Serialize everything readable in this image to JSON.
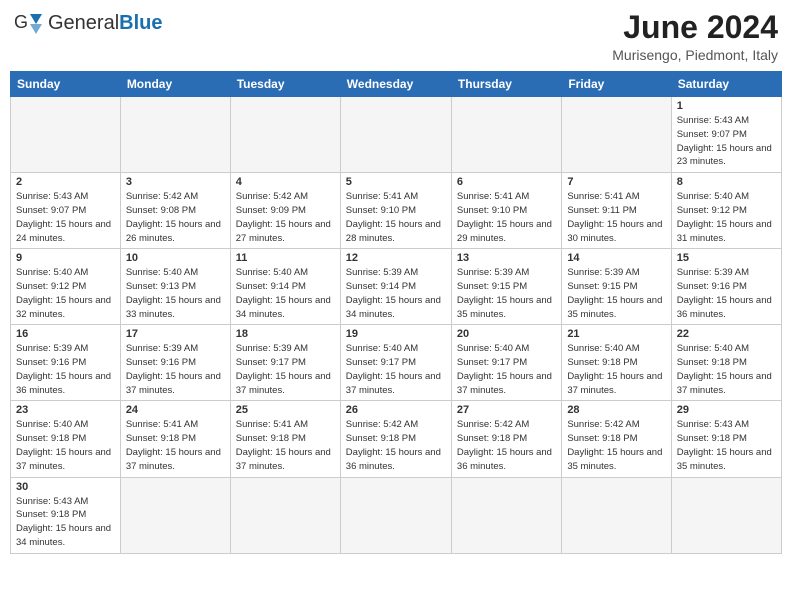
{
  "header": {
    "logo_general": "General",
    "logo_blue": "Blue",
    "month_title": "June 2024",
    "subtitle": "Murisengo, Piedmont, Italy"
  },
  "weekdays": [
    "Sunday",
    "Monday",
    "Tuesday",
    "Wednesday",
    "Thursday",
    "Friday",
    "Saturday"
  ],
  "weeks": [
    [
      {
        "day": "",
        "empty": true
      },
      {
        "day": "",
        "empty": true
      },
      {
        "day": "",
        "empty": true
      },
      {
        "day": "",
        "empty": true
      },
      {
        "day": "",
        "empty": true
      },
      {
        "day": "",
        "empty": true
      },
      {
        "day": "1",
        "info": "Sunrise: 5:43 AM\nSunset: 9:07 PM\nDaylight: 15 hours\nand 23 minutes."
      }
    ],
    [
      {
        "day": "2",
        "info": "Sunrise: 5:43 AM\nSunset: 9:07 PM\nDaylight: 15 hours\nand 24 minutes."
      },
      {
        "day": "3",
        "info": "Sunrise: 5:42 AM\nSunset: 9:08 PM\nDaylight: 15 hours\nand 26 minutes."
      },
      {
        "day": "4",
        "info": "Sunrise: 5:42 AM\nSunset: 9:09 PM\nDaylight: 15 hours\nand 27 minutes."
      },
      {
        "day": "5",
        "info": "Sunrise: 5:41 AM\nSunset: 9:10 PM\nDaylight: 15 hours\nand 28 minutes."
      },
      {
        "day": "6",
        "info": "Sunrise: 5:41 AM\nSunset: 9:10 PM\nDaylight: 15 hours\nand 29 minutes."
      },
      {
        "day": "7",
        "info": "Sunrise: 5:41 AM\nSunset: 9:11 PM\nDaylight: 15 hours\nand 30 minutes."
      },
      {
        "day": "8",
        "info": "Sunrise: 5:40 AM\nSunset: 9:12 PM\nDaylight: 15 hours\nand 31 minutes."
      }
    ],
    [
      {
        "day": "9",
        "info": "Sunrise: 5:40 AM\nSunset: 9:12 PM\nDaylight: 15 hours\nand 32 minutes."
      },
      {
        "day": "10",
        "info": "Sunrise: 5:40 AM\nSunset: 9:13 PM\nDaylight: 15 hours\nand 33 minutes."
      },
      {
        "day": "11",
        "info": "Sunrise: 5:40 AM\nSunset: 9:14 PM\nDaylight: 15 hours\nand 34 minutes."
      },
      {
        "day": "12",
        "info": "Sunrise: 5:39 AM\nSunset: 9:14 PM\nDaylight: 15 hours\nand 34 minutes."
      },
      {
        "day": "13",
        "info": "Sunrise: 5:39 AM\nSunset: 9:15 PM\nDaylight: 15 hours\nand 35 minutes."
      },
      {
        "day": "14",
        "info": "Sunrise: 5:39 AM\nSunset: 9:15 PM\nDaylight: 15 hours\nand 35 minutes."
      },
      {
        "day": "15",
        "info": "Sunrise: 5:39 AM\nSunset: 9:16 PM\nDaylight: 15 hours\nand 36 minutes."
      }
    ],
    [
      {
        "day": "16",
        "info": "Sunrise: 5:39 AM\nSunset: 9:16 PM\nDaylight: 15 hours\nand 36 minutes."
      },
      {
        "day": "17",
        "info": "Sunrise: 5:39 AM\nSunset: 9:16 PM\nDaylight: 15 hours\nand 37 minutes."
      },
      {
        "day": "18",
        "info": "Sunrise: 5:39 AM\nSunset: 9:17 PM\nDaylight: 15 hours\nand 37 minutes."
      },
      {
        "day": "19",
        "info": "Sunrise: 5:40 AM\nSunset: 9:17 PM\nDaylight: 15 hours\nand 37 minutes."
      },
      {
        "day": "20",
        "info": "Sunrise: 5:40 AM\nSunset: 9:17 PM\nDaylight: 15 hours\nand 37 minutes."
      },
      {
        "day": "21",
        "info": "Sunrise: 5:40 AM\nSunset: 9:18 PM\nDaylight: 15 hours\nand 37 minutes."
      },
      {
        "day": "22",
        "info": "Sunrise: 5:40 AM\nSunset: 9:18 PM\nDaylight: 15 hours\nand 37 minutes."
      }
    ],
    [
      {
        "day": "23",
        "info": "Sunrise: 5:40 AM\nSunset: 9:18 PM\nDaylight: 15 hours\nand 37 minutes."
      },
      {
        "day": "24",
        "info": "Sunrise: 5:41 AM\nSunset: 9:18 PM\nDaylight: 15 hours\nand 37 minutes."
      },
      {
        "day": "25",
        "info": "Sunrise: 5:41 AM\nSunset: 9:18 PM\nDaylight: 15 hours\nand 37 minutes."
      },
      {
        "day": "26",
        "info": "Sunrise: 5:42 AM\nSunset: 9:18 PM\nDaylight: 15 hours\nand 36 minutes."
      },
      {
        "day": "27",
        "info": "Sunrise: 5:42 AM\nSunset: 9:18 PM\nDaylight: 15 hours\nand 36 minutes."
      },
      {
        "day": "28",
        "info": "Sunrise: 5:42 AM\nSunset: 9:18 PM\nDaylight: 15 hours\nand 35 minutes."
      },
      {
        "day": "29",
        "info": "Sunrise: 5:43 AM\nSunset: 9:18 PM\nDaylight: 15 hours\nand 35 minutes."
      }
    ],
    [
      {
        "day": "30",
        "info": "Sunrise: 5:43 AM\nSunset: 9:18 PM\nDaylight: 15 hours\nand 34 minutes."
      },
      {
        "day": "",
        "empty": true
      },
      {
        "day": "",
        "empty": true
      },
      {
        "day": "",
        "empty": true
      },
      {
        "day": "",
        "empty": true
      },
      {
        "day": "",
        "empty": true
      },
      {
        "day": "",
        "empty": true
      }
    ]
  ]
}
